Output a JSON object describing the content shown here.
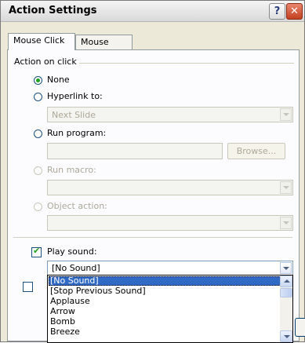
{
  "window": {
    "title": "Action Settings",
    "help_label": "?",
    "close_label": "✕"
  },
  "tabs": [
    {
      "label": "Mouse Click",
      "active": true
    },
    {
      "label": "Mouse Over",
      "active": false
    }
  ],
  "action_group": {
    "label": "Action on click",
    "none_label": "None",
    "hyperlink_label": "Hyperlink to:",
    "hyperlink_value": "Next Slide",
    "run_program_label": "Run program:",
    "run_program_value": "",
    "browse_label": "Browse...",
    "run_macro_label": "Run macro:",
    "object_action_label": "Object action:",
    "selected": "None"
  },
  "sound": {
    "play_sound_label": "Play sound:",
    "play_sound_checked": true,
    "selected_value": "[No Sound]",
    "options": [
      "[No Sound]",
      "[Stop Previous Sound]",
      "Applause",
      "Arrow",
      "Bomb",
      "Breeze"
    ],
    "highlighted_index": 0
  },
  "colors": {
    "dialog_bg": "#ece9d8",
    "selection": "#316ac5",
    "radio_check": "#21a121",
    "close_button": "#c3401f"
  }
}
